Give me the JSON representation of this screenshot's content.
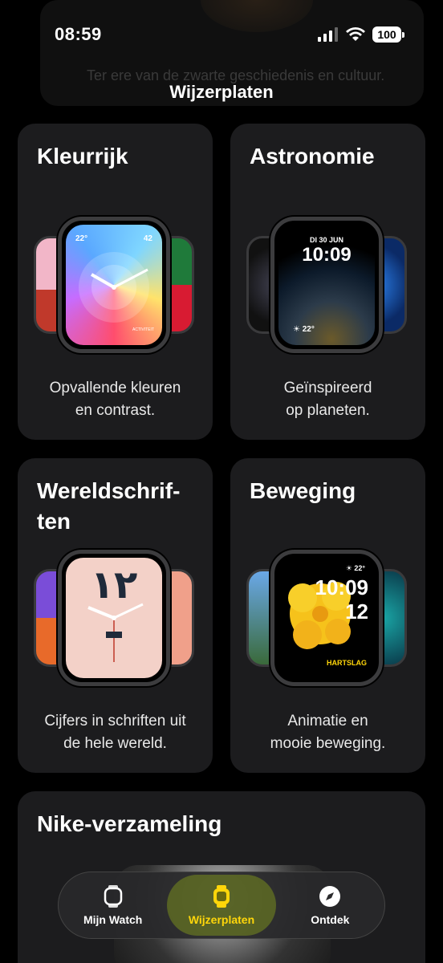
{
  "status": {
    "time": "08:59",
    "battery": "100"
  },
  "header": {
    "ghost_text": "Ter ere van de zwarte geschiedenis en cultuur.",
    "title": "Wijzerplaten"
  },
  "cards": [
    {
      "title": "Kleurrijk",
      "desc1": "Opvallende kleuren",
      "desc2": "en contrast."
    },
    {
      "title": "Astronomie",
      "desc1": "Geïnspireerd",
      "desc2": "op planeten."
    },
    {
      "title1": "Wereldschrif-",
      "title2": "ten",
      "desc1": "Cijfers in schriften uit",
      "desc2": "de hele wereld."
    },
    {
      "title": "Beweging",
      "desc1": "Animatie en",
      "desc2": "mooie beweging."
    },
    {
      "title": "Nike-verzameling"
    }
  ],
  "faces": {
    "kleurrijk": {
      "left_temp": "22°",
      "right_temp": "42",
      "activity": "ACTIVITEIT"
    },
    "astronomie": {
      "date": "DI 30 JUN",
      "time": "10:09",
      "temp": "22°"
    },
    "wereldschriften": {
      "numerals": "١٢"
    },
    "beweging": {
      "temp": "22°",
      "hour": "10:09",
      "minute": "12",
      "label": "HARTSLAG"
    }
  },
  "tabs": [
    {
      "label": "Mijn Watch",
      "icon": "watch-icon"
    },
    {
      "label": "Wijzerplaten",
      "icon": "watchface-icon",
      "active": true
    },
    {
      "label": "Ontdek",
      "icon": "compass-icon"
    }
  ],
  "colors": {
    "accent": "#ffd60a",
    "card": "#1c1c1e"
  }
}
